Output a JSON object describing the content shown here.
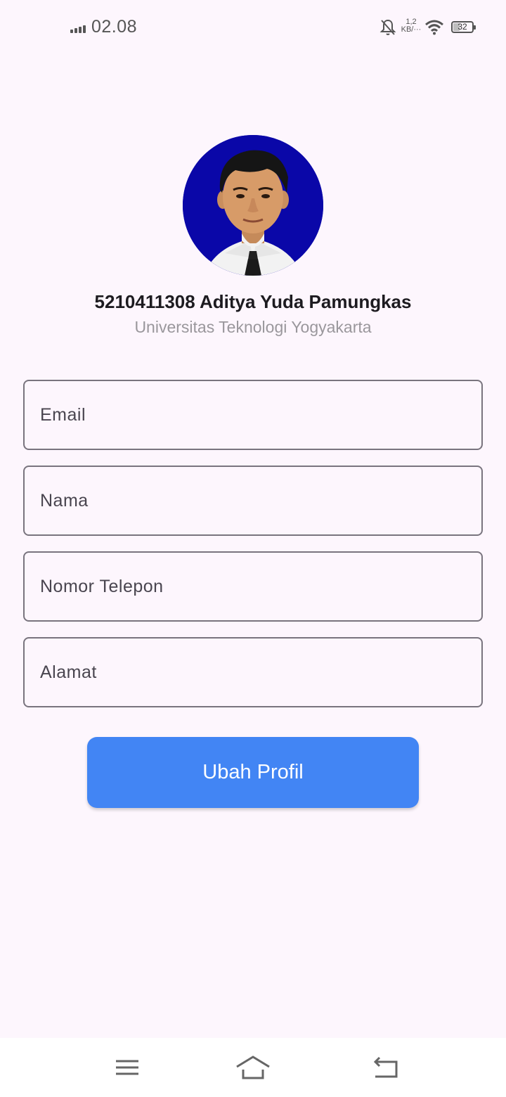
{
  "status_bar": {
    "time": "02.08",
    "net_speed_value": "1,2",
    "net_speed_unit": "KB/···",
    "battery": "32",
    "icons": [
      "signal-icon",
      "bell-off-icon",
      "wifi-icon",
      "battery-icon"
    ]
  },
  "profile": {
    "avatar": "profile-photo",
    "name": "5210411308 Aditya Yuda Pamungkas",
    "university": "Universitas Teknologi Yogyakarta"
  },
  "form": {
    "email_placeholder": "Email",
    "name_placeholder": "Nama",
    "phone_placeholder": "Nomor Telepon",
    "address_placeholder": "Alamat",
    "submit_label": "Ubah Profil"
  },
  "nav": {
    "icons": [
      "menu-icon",
      "home-icon",
      "back-icon"
    ]
  },
  "colors": {
    "background": "#fdf6fd",
    "button": "#4285f4",
    "avatar_background": "#0a07a8"
  }
}
